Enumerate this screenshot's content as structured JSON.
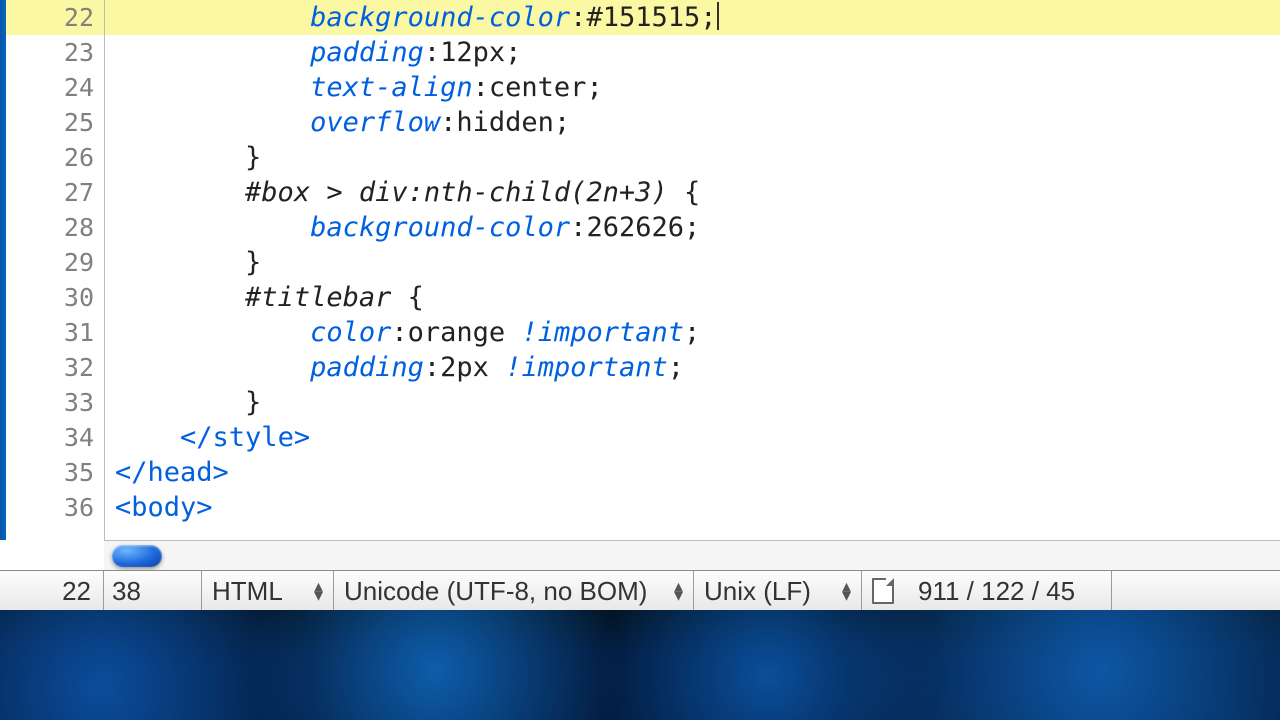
{
  "gutter": {
    "first_line": 22,
    "lines": [
      22,
      23,
      24,
      25,
      26,
      27,
      28,
      29,
      30,
      31,
      32,
      33,
      34,
      35,
      36
    ],
    "highlight_line": 22
  },
  "code": {
    "l22": {
      "prop": "background-color",
      "val": "#151515",
      "sep": ":",
      "end": ";"
    },
    "l23": {
      "prop": "padding",
      "val": "12px",
      "sep": ":",
      "end": ";"
    },
    "l24": {
      "prop": "text-align",
      "val": "center",
      "sep": ":",
      "end": ";"
    },
    "l25": {
      "prop": "overflow",
      "val": "hidden",
      "sep": ":",
      "end": ";"
    },
    "l26": {
      "brace": "}"
    },
    "l27": {
      "sel": "#box > div:nth-child(2n+3)",
      "brace": "{"
    },
    "l28": {
      "prop": "background-color",
      "val": "262626",
      "sep": ":",
      "end": ";"
    },
    "l29": {
      "brace": "}"
    },
    "l30": {
      "sel": "#titlebar",
      "brace": "{"
    },
    "l31": {
      "prop": "color",
      "val": "orange",
      "imp": "!important",
      "sep": ":",
      "end": ";"
    },
    "l32": {
      "prop": "padding",
      "val": "2px",
      "imp": "!important",
      "sep": ":",
      "end": ";"
    },
    "l33": {
      "brace": "}"
    },
    "l34": {
      "tag": "</style>"
    },
    "l35": {
      "tag": "</head>"
    },
    "l36": {
      "tag": "<body>"
    }
  },
  "status": {
    "line": "22",
    "col": "38",
    "lang": "HTML",
    "encoding": "Unicode (UTF-8, no BOM)",
    "eol": "Unix (LF)",
    "stats": "911 / 122 / 45"
  }
}
